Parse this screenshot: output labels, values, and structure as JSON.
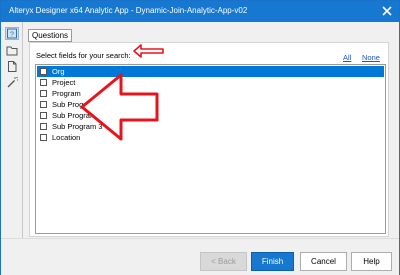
{
  "window": {
    "title": "Alteryx Designer x64 Analytic App - Dynamic-Join-Analytic-App-v02"
  },
  "sidebar": {
    "icons": [
      "help-icon",
      "folder-open-icon",
      "document-icon",
      "magic-wand-icon"
    ]
  },
  "tab": {
    "label": "Questions"
  },
  "question": {
    "prompt": "Select fields for your search:",
    "all_label": "All",
    "none_label": "None"
  },
  "fields": [
    {
      "label": "Org",
      "checked": false,
      "selected": true
    },
    {
      "label": "Project",
      "checked": false,
      "selected": false
    },
    {
      "label": "Program",
      "checked": false,
      "selected": false
    },
    {
      "label": "Sub Program",
      "checked": false,
      "selected": false
    },
    {
      "label": "Sub Program 2",
      "checked": false,
      "selected": false
    },
    {
      "label": "Sub Program 3",
      "checked": false,
      "selected": false
    },
    {
      "label": "Location",
      "checked": false,
      "selected": false
    }
  ],
  "buttons": {
    "back": "< Back",
    "finish": "Finish",
    "cancel": "Cancel",
    "help": "Help"
  },
  "colors": {
    "titlebar": "#1778d2",
    "selection": "#0078d7",
    "annotation": "#e8141b"
  }
}
